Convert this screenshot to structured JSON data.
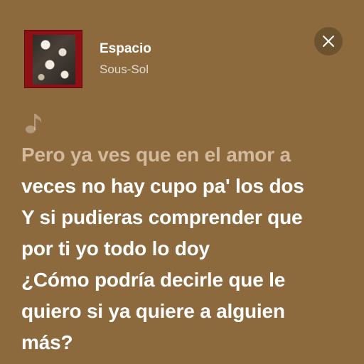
{
  "now_playing": {
    "title": "Espacio",
    "artist": "Sous-Sol",
    "album_art_icon": "album-cover"
  },
  "controls": {
    "close_icon": "close-icon"
  },
  "lyrics": {
    "indicator_icon": "music-note-icon",
    "lines": [
      {
        "text": "Pero ya ves que en el amor a",
        "state": "past"
      },
      {
        "text": "veces no hay cupo pa' los dos",
        "state": "current"
      },
      {
        "text": "Y si pudieras comprender que",
        "state": "current"
      },
      {
        "text": "por ti yo todo lo doy",
        "state": "current"
      },
      {
        "text": "¿Cómo podría decirle que le",
        "state": "current"
      },
      {
        "text": "quiero si ya quiere a alguien",
        "state": "current"
      },
      {
        "text": "más?",
        "state": "current"
      }
    ]
  },
  "colors": {
    "background": "#8c6a3e",
    "active_text": "#ffffff",
    "past_text": "#e8d8c4"
  }
}
